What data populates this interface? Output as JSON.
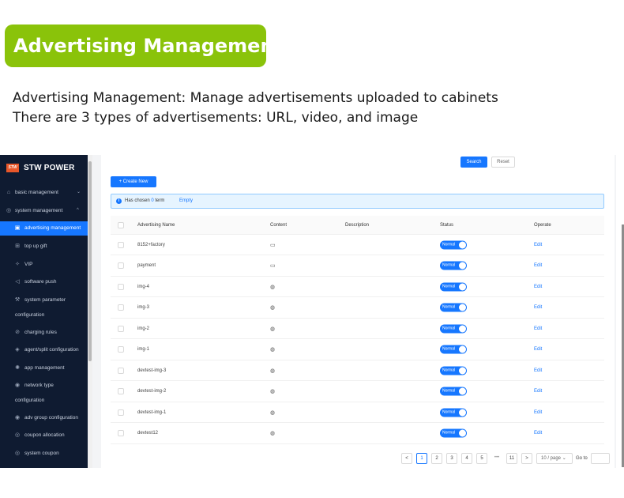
{
  "heading": "Advertising Management",
  "description": [
    "Advertising Management: Manage advertisements uploaded to cabinets",
    "There are 3 types of advertisements: URL, video, and image"
  ],
  "app": {
    "logo_text": "STW",
    "brand": "STW POWER"
  },
  "sidebar": {
    "groups": [
      {
        "label": "basic management",
        "icon": "home-icon",
        "chevron": "⌄"
      },
      {
        "label": "system management",
        "icon": "settings-icon",
        "chevron": "^"
      }
    ],
    "items": [
      {
        "label": "advertising management",
        "icon": "image-icon",
        "active": true
      },
      {
        "label": "top up gift",
        "icon": "gift-icon"
      },
      {
        "label": "VIP",
        "icon": "vip-icon"
      },
      {
        "label": "software push",
        "icon": "send-icon"
      },
      {
        "label": "system parameter",
        "label2": "configuration",
        "icon": "wrench-icon"
      },
      {
        "label": "charging rules",
        "icon": "charge-icon"
      },
      {
        "label": "agent/split configuration",
        "icon": "agent-icon"
      },
      {
        "label": "app management",
        "icon": "app-icon"
      },
      {
        "label": "network type",
        "label2": "configuration",
        "icon": "network-icon"
      },
      {
        "label": "adv group configuration",
        "icon": "group-icon"
      },
      {
        "label": "coupon allocation",
        "icon": "coupon-icon"
      },
      {
        "label": "system coupon",
        "icon": "ticket-icon"
      }
    ]
  },
  "toolbar": {
    "search_label": "Search",
    "reset_label": "Reset",
    "create_label": "+ Create New"
  },
  "selection": {
    "prefix": "Has chosen",
    "count": "0",
    "suffix": "term",
    "empty_label": "Empty"
  },
  "table": {
    "columns": [
      "Advertising Name",
      "Content",
      "Description",
      "Status",
      "Operate"
    ],
    "rows": [
      {
        "name": "8152+factory",
        "content_icon": "video-icon",
        "description": "",
        "status": "Normal",
        "action": "Edit"
      },
      {
        "name": "payment",
        "content_icon": "video-icon",
        "description": "",
        "status": "Normal",
        "action": "Edit"
      },
      {
        "name": "img-4",
        "content_icon": "image-content-icon",
        "description": "",
        "status": "Normal",
        "action": "Edit"
      },
      {
        "name": "img-3",
        "content_icon": "image-content-icon",
        "description": "",
        "status": "Normal",
        "action": "Edit"
      },
      {
        "name": "img-2",
        "content_icon": "image-content-icon",
        "description": "",
        "status": "Normal",
        "action": "Edit"
      },
      {
        "name": "img-1",
        "content_icon": "image-content-icon",
        "description": "",
        "status": "Normal",
        "action": "Edit"
      },
      {
        "name": "devtest-img-3",
        "content_icon": "image-content-icon",
        "description": "",
        "status": "Normal",
        "action": "Edit"
      },
      {
        "name": "devtest-img-2",
        "content_icon": "image-content-icon",
        "description": "",
        "status": "Normal",
        "action": "Edit"
      },
      {
        "name": "devtest-img-1",
        "content_icon": "image-content-icon",
        "description": "",
        "status": "Normal",
        "action": "Edit"
      },
      {
        "name": "devtest12",
        "content_icon": "image-content-icon",
        "description": "",
        "status": "Normal",
        "action": "Edit"
      }
    ]
  },
  "pagination": {
    "prev": "<",
    "pages": [
      "1",
      "2",
      "3",
      "4",
      "5"
    ],
    "ellipsis": "•••",
    "last": "11",
    "next": ">",
    "current": "1",
    "page_size": "10 / page",
    "goto_label": "Go to"
  },
  "colors": {
    "badge": "#8ac30a",
    "sidebar_bg": "#0f1b31",
    "primary": "#1677ff"
  }
}
